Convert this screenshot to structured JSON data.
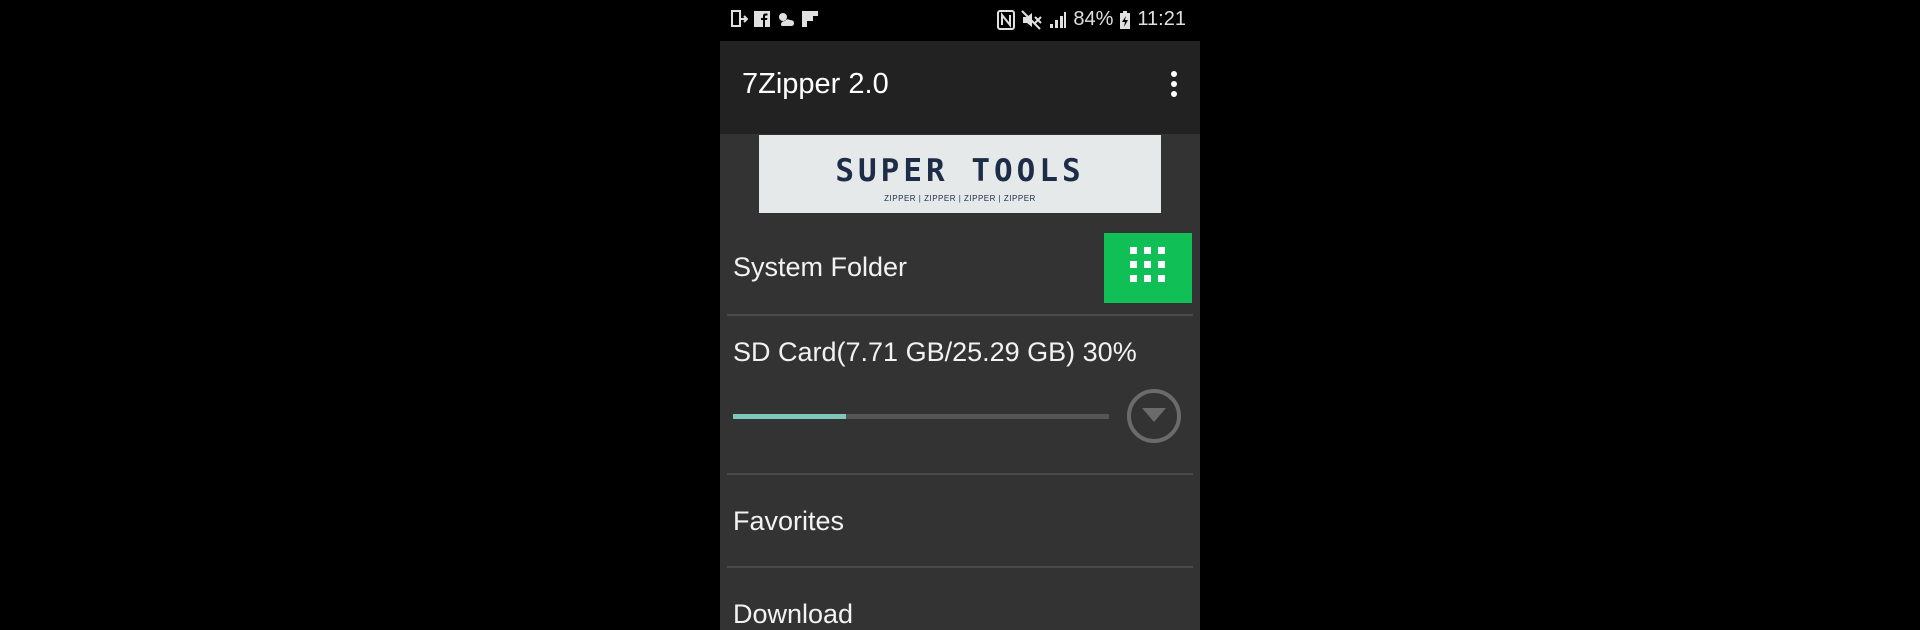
{
  "status_bar": {
    "left_icons": [
      "screen-cast-icon",
      "facebook-icon",
      "weather-icon",
      "flipboard-icon"
    ],
    "right_icons": [
      "nfc-icon",
      "mute-icon",
      "signal-icon"
    ],
    "battery": "84%",
    "time": "11:21"
  },
  "app_bar": {
    "title": "7Zipper 2.0",
    "menu_icon": "more-vert-icon"
  },
  "banner": {
    "title": "SUPER TOOLS",
    "subtitle": "ZIPPER | ZIPPER | ZIPPER | ZIPPER"
  },
  "list": {
    "system_folder": {
      "label": "System Folder",
      "icon": "apps-grid-icon"
    },
    "sd_card": {
      "label": "SD Card(7.71 GB/25.29 GB) 30%",
      "usage_fraction": 0.3,
      "expand_icon": "expand-circle-icon"
    },
    "favorites": {
      "label": "Favorites"
    },
    "download": {
      "label": "Download"
    }
  },
  "colors": {
    "accent_green": "#10c057",
    "progress_fill": "#7fc7bd",
    "background": "#333333",
    "app_bar": "#222222"
  }
}
